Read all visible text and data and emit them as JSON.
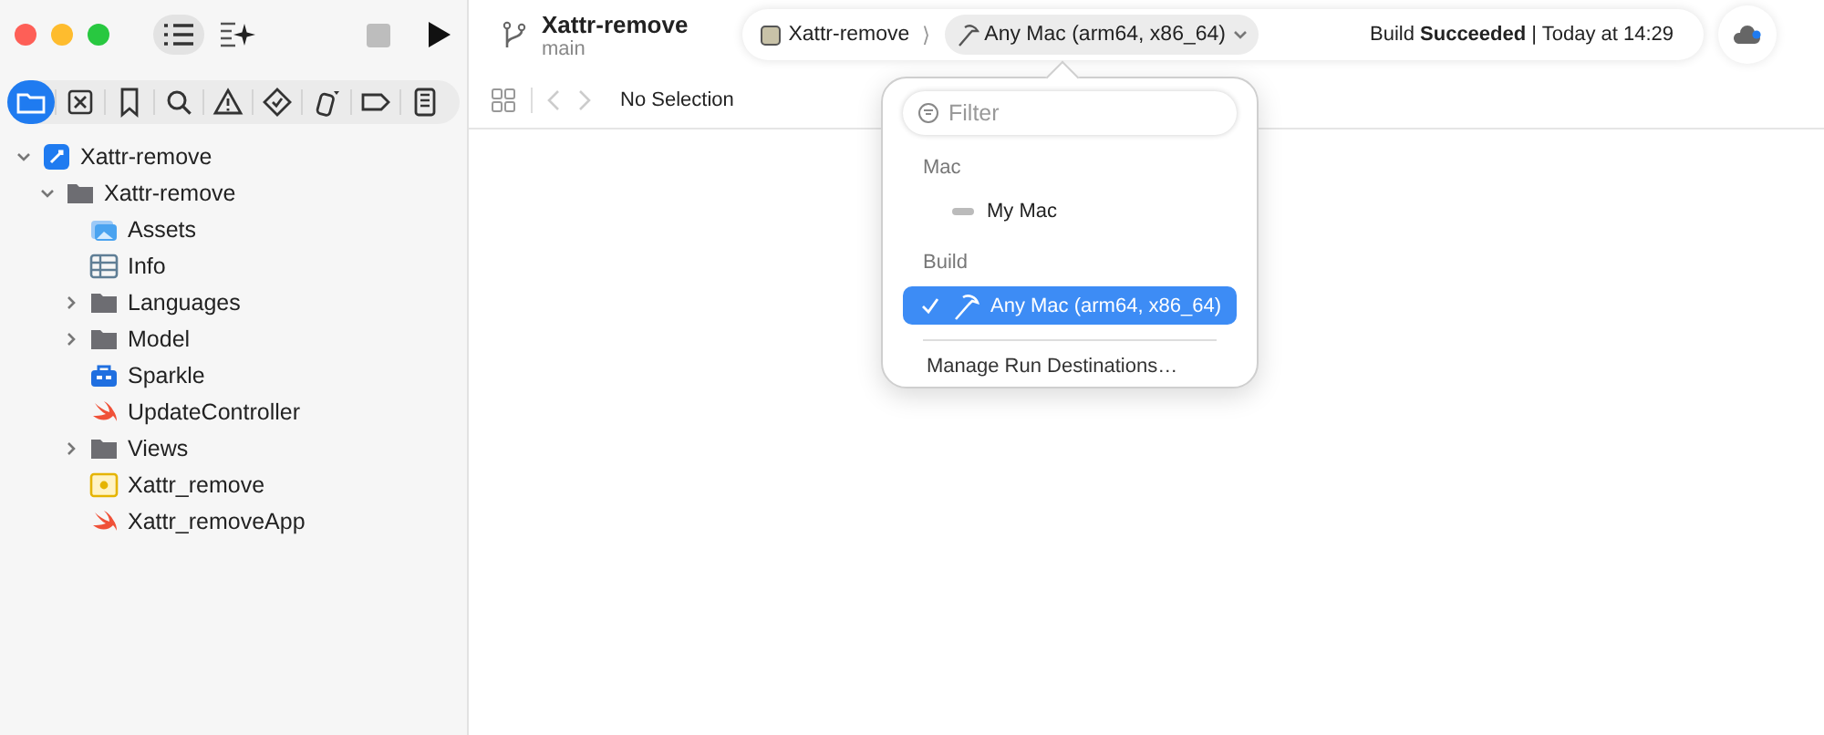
{
  "window": {
    "title": "Xattr-remove",
    "branch": "main"
  },
  "navigator_tabs": [
    {
      "kind": "folder",
      "selected": true
    },
    {
      "kind": "source-control",
      "selected": false
    },
    {
      "kind": "bookmark",
      "selected": false
    },
    {
      "kind": "search",
      "selected": false
    },
    {
      "kind": "warning",
      "selected": false
    },
    {
      "kind": "test",
      "selected": false
    },
    {
      "kind": "debug",
      "selected": false
    },
    {
      "kind": "breakpoint",
      "selected": false
    },
    {
      "kind": "report",
      "selected": false
    }
  ],
  "tree": [
    {
      "name": "Xattr-remove",
      "kind": "project",
      "expanded": true,
      "children": [
        {
          "name": "Xattr-remove",
          "kind": "folder",
          "expanded": true,
          "children": [
            {
              "name": "Assets",
              "kind": "assets"
            },
            {
              "name": "Info",
              "kind": "plist"
            },
            {
              "name": "Languages",
              "kind": "folder",
              "expanded": false
            },
            {
              "name": "Model",
              "kind": "folder",
              "expanded": false
            },
            {
              "name": "Sparkle",
              "kind": "package"
            },
            {
              "name": "UpdateController",
              "kind": "swift"
            },
            {
              "name": "Views",
              "kind": "folder",
              "expanded": false
            },
            {
              "name": "Xattr_remove",
              "kind": "entitlements"
            },
            {
              "name": "Xattr_removeApp",
              "kind": "swift"
            }
          ]
        }
      ]
    }
  ],
  "scheme": {
    "name": "Xattr-remove",
    "separator": "⟩",
    "destination": "Any Mac (arm64, x86_64)"
  },
  "status": "Build **Succeeded** | Today at 14:29",
  "jump_bar": {
    "text": "No Selection"
  },
  "popover": {
    "filter_placeholder": "Filter",
    "sections": [
      {
        "heading": "Mac",
        "items": [
          {
            "name": "My Mac",
            "kind": "mac",
            "selected": false
          }
        ]
      },
      {
        "heading": "Build",
        "items": [
          {
            "name": "Any Mac (arm64, x86_64)",
            "kind": "build",
            "selected": true
          }
        ]
      }
    ],
    "footer": "Manage Run Destinations…"
  }
}
